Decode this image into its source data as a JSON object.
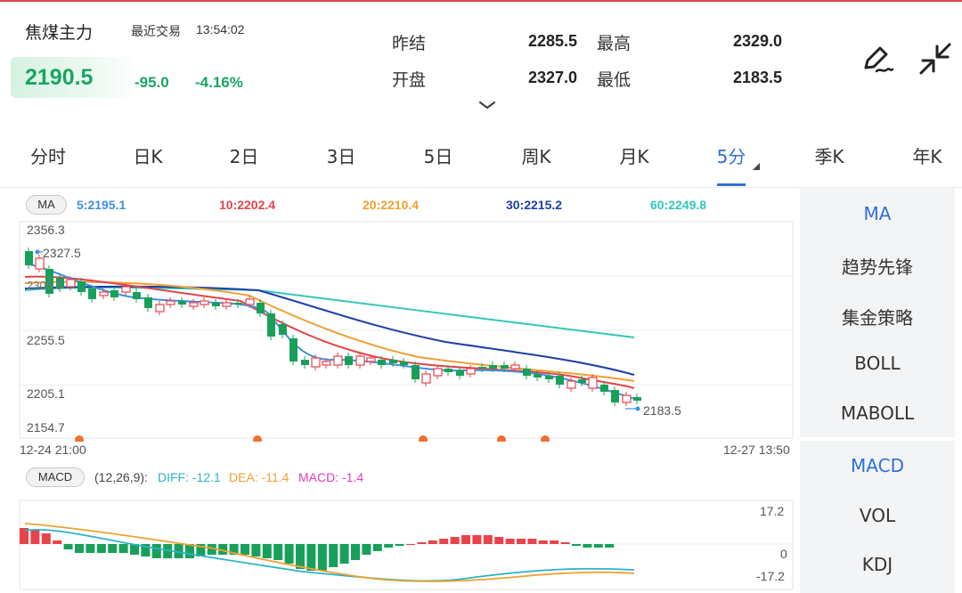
{
  "header": {
    "name": "焦煤主力",
    "recent_trade_label": "最近交易",
    "time": "13:54:02",
    "price": "2190.5",
    "change": "-95.0",
    "change_pct": "-4.16%",
    "quotes": [
      {
        "label": "昨结",
        "value": "2285.5"
      },
      {
        "label": "最高",
        "value": "2329.0"
      },
      {
        "label": "开盘",
        "value": "2327.0"
      },
      {
        "label": "最低",
        "value": "2183.5"
      }
    ]
  },
  "tabs": [
    "分时",
    "日K",
    "2日",
    "3日",
    "5日",
    "周K",
    "月K",
    "5分",
    "季K",
    "年K"
  ],
  "active_tab": "5分",
  "ma_legend": {
    "badge": "MA",
    "items": [
      {
        "text": "5:2195.1",
        "color": "#3f8fe0"
      },
      {
        "text": "10:2202.4",
        "color": "#e0454b"
      },
      {
        "text": "20:2210.4",
        "color": "#f0a030"
      },
      {
        "text": "30:2215.2",
        "color": "#1f3fa8"
      },
      {
        "text": "60:2249.8",
        "color": "#30c8b8"
      }
    ]
  },
  "price_axis": [
    "2356.3",
    "2255.5",
    "2205.1",
    "2154.7"
  ],
  "marks": {
    "high": "2327.5",
    "low": "2183.5",
    "partial": "2305.8"
  },
  "time_axis": {
    "start": "12-24 21:00",
    "end": "12-27 13:50"
  },
  "macd_legend": {
    "badge": "MACD",
    "params": "(12,26,9):",
    "items": [
      {
        "text": "DIFF: -12.1",
        "color": "#2bb3c9"
      },
      {
        "text": "DEA: -11.4",
        "color": "#f0a030"
      },
      {
        "text": "MACD: -1.4",
        "color": "#e03fb8"
      }
    ]
  },
  "macd_axis": [
    "17.2",
    "0",
    "-17.2"
  ],
  "side_main": [
    "MA",
    "趋势先锋",
    "集金策略",
    "BOLL",
    "MABOLL"
  ],
  "side_sub": [
    "MACD",
    "VOL",
    "KDJ"
  ],
  "colors": {
    "up": "#e8434b",
    "down": "#18a05a",
    "accent": "#2f6fd6"
  },
  "icons": {
    "draw": "pen-draw-icon",
    "collapse": "collapse-arrows-icon",
    "expand": "chevron-down-icon"
  }
}
